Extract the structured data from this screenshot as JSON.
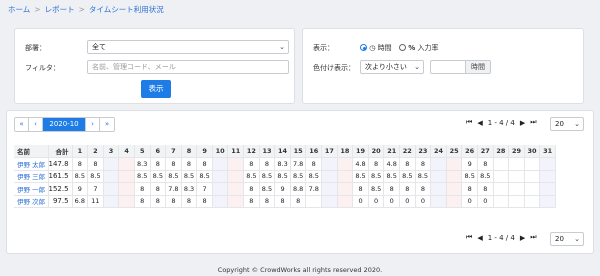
{
  "breadcrumb": {
    "items": [
      "ホーム",
      "レポート",
      "タイムシート利用状況"
    ],
    "separator": ">"
  },
  "filters": {
    "dept_label": "部署：",
    "dept_value": "全て",
    "filter_label": "フィルタ：",
    "filter_placeholder": "名前、管理コード、メール",
    "submit_label": "表示"
  },
  "display": {
    "label": "表示：",
    "opt_time": "時間",
    "opt_rate": "入力率",
    "color_label": "色付け表示：",
    "color_value": "次より小さい",
    "unit": "時間"
  },
  "pager": {
    "first": "«",
    "prev": "‹",
    "month": "2020-10",
    "next": "›",
    "last": "»"
  },
  "right_pager": {
    "first": "⏮",
    "prev": "◀",
    "range": "1 - 4 / 4",
    "next": "▶",
    "last": "⏭",
    "page_size": "20"
  },
  "table": {
    "headers": {
      "name": "名前",
      "total": "合計"
    },
    "days": [
      "1",
      "2",
      "3",
      "4",
      "5",
      "6",
      "7",
      "8",
      "9",
      "10",
      "11",
      "12",
      "13",
      "14",
      "15",
      "16",
      "17",
      "18",
      "19",
      "20",
      "21",
      "22",
      "23",
      "24",
      "25",
      "26",
      "27",
      "28",
      "29",
      "30",
      "31"
    ],
    "weekend_sat": [
      3,
      10,
      17,
      24,
      31
    ],
    "weekend_sun": [
      4,
      11,
      18,
      25
    ],
    "rows": [
      {
        "name": "伊野 太郎",
        "total": "147.8",
        "cells": [
          "8",
          "8",
          "",
          "",
          "8.3",
          "8",
          "8",
          "8",
          "8",
          "",
          "",
          "8",
          "8",
          "8.3",
          "7.8",
          "8",
          "",
          "",
          "4.8",
          "8",
          "4.8",
          "8",
          "8",
          "",
          "",
          "9",
          "8",
          "",
          "",
          "",
          ""
        ]
      },
      {
        "name": "伊野 三郎",
        "total": "161.5",
        "cells": [
          "8.5",
          "8.5",
          "",
          "",
          "8.5",
          "8.5",
          "8.5",
          "8.5",
          "8.5",
          "",
          "",
          "8.5",
          "8.5",
          "8.5",
          "8.5",
          "8.5",
          "",
          "",
          "8.5",
          "8.5",
          "8.5",
          "8.5",
          "8.5",
          "",
          "",
          "8.5",
          "8.5",
          "",
          "",
          "",
          ""
        ]
      },
      {
        "name": "伊野 一郎",
        "total": "152.5",
        "cells": [
          "9",
          "7",
          "",
          "",
          "8",
          "8",
          "7.8",
          "8.3",
          "7",
          "",
          "",
          "8",
          "8.5",
          "9",
          "8.8",
          "7.8",
          "",
          "",
          "8",
          "8.5",
          "8",
          "8",
          "8",
          "",
          "",
          "8",
          "8",
          "",
          "",
          "",
          ""
        ]
      },
      {
        "name": "伊野 次郎",
        "total": "97.5",
        "cells": [
          "6.8",
          "11",
          "",
          "",
          "8",
          "8",
          "8",
          "8",
          "8",
          "",
          "",
          "8",
          "8",
          "8",
          "8",
          "",
          "",
          "",
          "0",
          "0",
          "0",
          "0",
          "0",
          "",
          "",
          "0",
          "0",
          "",
          "",
          "",
          ""
        ]
      }
    ]
  },
  "footer": "Copyright © CrowdWorks all rights reserved 2020."
}
